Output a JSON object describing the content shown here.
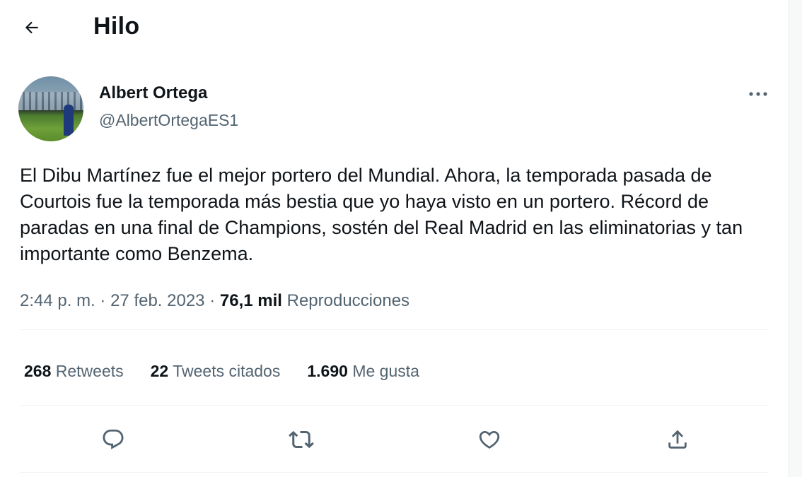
{
  "header": {
    "title": "Hilo",
    "back_icon": "arrow-left-icon"
  },
  "tweet": {
    "author": {
      "display_name": "Albert Ortega",
      "handle": "@AlbertOrtegaES1"
    },
    "text": "El Dibu Martínez fue el mejor portero del Mundial. Ahora, la temporada pasada de Courtois fue la temporada más bestia que yo haya visto en un portero. Récord de paradas en una final de Champions, sostén del Real Madrid en las eliminatorias y tan importante como Benzema.",
    "time": "2:44 p. m.",
    "separator": "·",
    "date": "27 feb. 2023",
    "views_count": "76,1 mil",
    "views_label": "Reproducciones",
    "stats": {
      "retweets_count": "268",
      "retweets_label": "Retweets",
      "quotes_count": "22",
      "quotes_label": "Tweets citados",
      "likes_count": "1.690",
      "likes_label": "Me gusta"
    },
    "actions": [
      "reply-icon",
      "retweet-icon",
      "like-icon",
      "share-icon"
    ]
  },
  "colors": {
    "text_primary": "#0f1419",
    "text_secondary": "#536471",
    "divider": "#eff3f4"
  }
}
